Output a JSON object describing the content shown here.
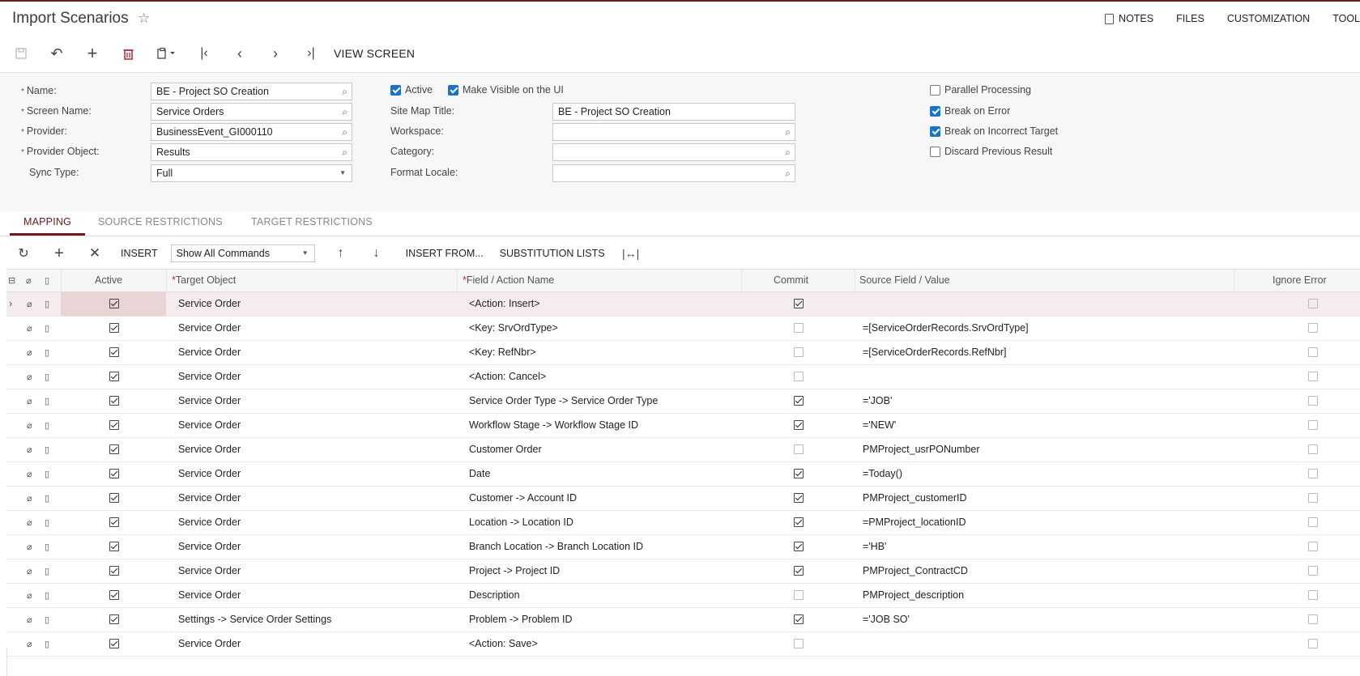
{
  "header": {
    "title": "Import Scenarios",
    "links": [
      "NOTES",
      "FILES",
      "CUSTOMIZATION",
      "TOOL"
    ]
  },
  "toolbar": {
    "view_screen": "VIEW SCREEN"
  },
  "form": {
    "name_label": "Name:",
    "name_value": "BE - Project SO Creation",
    "screen_name_label": "Screen Name:",
    "screen_name_value": "Service Orders",
    "provider_label": "Provider:",
    "provider_value": "BusinessEvent_GI000110",
    "provider_object_label": "Provider Object:",
    "provider_object_value": "Results",
    "sync_type_label": "Sync Type:",
    "sync_type_value": "Full",
    "active_label": "Active",
    "make_visible_label": "Make Visible on the UI",
    "site_map_title_label": "Site Map Title:",
    "site_map_title_value": "BE - Project SO Creation",
    "workspace_label": "Workspace:",
    "workspace_value": "",
    "category_label": "Category:",
    "category_value": "",
    "format_locale_label": "Format Locale:",
    "format_locale_value": "",
    "parallel_label": "Parallel Processing",
    "break_error_label": "Break on Error",
    "break_target_label": "Break on Incorrect Target",
    "discard_label": "Discard Previous Result"
  },
  "tabs": [
    "MAPPING",
    "SOURCE RESTRICTIONS",
    "TARGET RESTRICTIONS"
  ],
  "grid_toolbar": {
    "insert": "INSERT",
    "command_filter": "Show All Commands",
    "insert_from": "INSERT FROM...",
    "substitution": "SUBSTITUTION LISTS"
  },
  "columns": {
    "active": "Active",
    "target_object": "Target Object",
    "field_action": "Field / Action Name",
    "commit": "Commit",
    "source": "Source Field / Value",
    "ignore_error": "Ignore Error"
  },
  "rows": [
    {
      "active": true,
      "target": "Service Order",
      "field": "<Action: Insert>",
      "commit": true,
      "source": "",
      "ignore": false
    },
    {
      "active": true,
      "target": "Service Order",
      "field": "<Key: SrvOrdType>",
      "commit": false,
      "source": "=[ServiceOrderRecords.SrvOrdType]",
      "ignore": false
    },
    {
      "active": true,
      "target": "Service Order",
      "field": "<Key: RefNbr>",
      "commit": false,
      "source": "=[ServiceOrderRecords.RefNbr]",
      "ignore": false
    },
    {
      "active": true,
      "target": "Service Order",
      "field": "<Action: Cancel>",
      "commit": false,
      "source": "",
      "ignore": false
    },
    {
      "active": true,
      "target": "Service Order",
      "field": "Service Order Type -> Service Order Type",
      "commit": true,
      "source": "='JOB'",
      "ignore": false
    },
    {
      "active": true,
      "target": "Service Order",
      "field": "Workflow Stage -> Workflow Stage ID",
      "commit": true,
      "source": "='NEW'",
      "ignore": false
    },
    {
      "active": true,
      "target": "Service Order",
      "field": "Customer Order",
      "commit": false,
      "source": "PMProject_usrPONumber",
      "ignore": false
    },
    {
      "active": true,
      "target": "Service Order",
      "field": "Date",
      "commit": true,
      "source": "=Today()",
      "ignore": false
    },
    {
      "active": true,
      "target": "Service Order",
      "field": "Customer -> Account ID",
      "commit": true,
      "source": "PMProject_customerID",
      "ignore": false
    },
    {
      "active": true,
      "target": "Service Order",
      "field": "Location -> Location ID",
      "commit": true,
      "source": "=PMProject_locationID",
      "ignore": false
    },
    {
      "active": true,
      "target": "Service Order",
      "field": "Branch Location -> Branch Location ID",
      "commit": true,
      "source": "='HB'",
      "ignore": false
    },
    {
      "active": true,
      "target": "Service Order",
      "field": "Project -> Project ID",
      "commit": true,
      "source": "PMProject_ContractCD",
      "ignore": false
    },
    {
      "active": true,
      "target": "Service Order",
      "field": "Description",
      "commit": false,
      "source": "PMProject_description",
      "ignore": false
    },
    {
      "active": true,
      "target": "Settings -> Service Order Settings",
      "field": "Problem -> Problem ID",
      "commit": true,
      "source": "='JOB SO'",
      "ignore": false
    },
    {
      "active": true,
      "target": "Service Order",
      "field": "<Action: Save>",
      "commit": false,
      "source": "",
      "ignore": false
    }
  ]
}
